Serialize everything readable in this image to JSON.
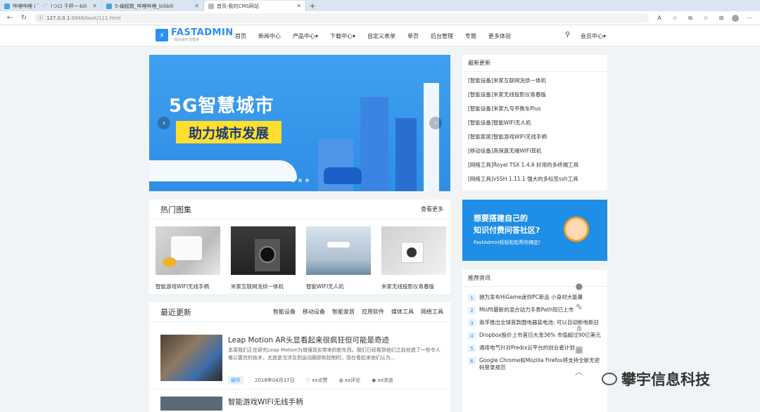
{
  "browser": {
    "tabs": [
      {
        "title": "哔哩哔哩 ( ゜- ゜)つロ 干杯~-bili"
      },
      {
        "title": "5-编程数_哔哩哔哩_bilibili"
      },
      {
        "title": "首页-我的CMS网站",
        "active": true
      }
    ],
    "url_host": "127.0.0.1",
    "url_path": ":8848/boot/111.html"
  },
  "site": {
    "brand": "FASTADMIN",
    "slogan": "一款快速开发框架",
    "nav": [
      "首页",
      "新闻中心",
      "产品中心▾",
      "下载中心▾",
      "自定义表单",
      "单页",
      "后台管理",
      "专题",
      "更多体验"
    ],
    "member": "会员中心▾"
  },
  "banner": {
    "title": "5G智慧城市",
    "subtitle": "助力城市发展"
  },
  "gallery": {
    "title": "热门图集",
    "more": "查看更多",
    "items": [
      {
        "caption": "智能游戏WIFI无线手柄"
      },
      {
        "caption": "米家互联网洗烘一体机"
      },
      {
        "caption": "智能WIFI无人机"
      },
      {
        "caption": "米家无线投影仪青春版"
      }
    ]
  },
  "latest": {
    "title": "最近更新",
    "categories": [
      "智能设备",
      "移动设备",
      "智能家居",
      "应用软件",
      "媒体工具",
      "网络工具"
    ],
    "article": {
      "title": "Leap Motion AR头显看起来很疯狂但可能是奇迹",
      "desc": "本周我们正在研究Leap Motion为增强现实带来的新东西。我们已经看到他们之前创造了一些令人难以置信的技术，尤其是当涉及到运动跟踪和控制时。现在看起来他们认为...",
      "tag": "硬件",
      "date": "2018年04月17日",
      "likes": "xx点赞",
      "comments": "xx评论",
      "views": "xx浏览"
    },
    "article2_title": "智能游戏WIFI无线手柄"
  },
  "sidebar_new": {
    "title": "最新更新",
    "items": [
      "[智能设备]米家互联网洗烘一体机",
      "[智能设备]米家无线投影仪青春版",
      "[智能设备]米家九号平衡车Plus",
      "[智能设备]智能WIFI无人机",
      "[智能家居]智能游戏WIFI无线手柄",
      "[移动设备]高保真无绳WIFI耳机",
      "[网络工具]Royal TSX 1.4.6 好用的多终端工具",
      "[网络工具]vSSH 1.11.1 强大的多标签ssh工具"
    ]
  },
  "ad": {
    "line1": "想要搭建自己的",
    "line2": "知识付费问答社区?",
    "line3": "FastAdmin轻轻松松帮你搞定!"
  },
  "recommend": {
    "title": "推荐资讯",
    "items": [
      {
        "n": "1",
        "text": "驰为发布HiGame迷你PC新品 小身材大能量"
      },
      {
        "n": "2",
        "text": "Misfit最新的混合动力手表Path现已上市"
      },
      {
        "n": "3",
        "text": "南孚推出全球首款圆电器装电池: 可以自动断电新旧"
      },
      {
        "n": "4",
        "text": "Dropbox股价上市首日大涨36% 市值超过90亿美元"
      },
      {
        "n": "5",
        "text": "通用电气针对Predix云平台的创业者计划"
      },
      {
        "n": "6",
        "text": "Google Chrome和Mozilla Firefox将支持全新无密码登录规范"
      }
    ]
  },
  "watermark": "攀宇信息科技",
  "colors": {
    "accent": "#2c8ef8",
    "banner": "#3fa0f0",
    "yellow": "#ffde2e"
  }
}
